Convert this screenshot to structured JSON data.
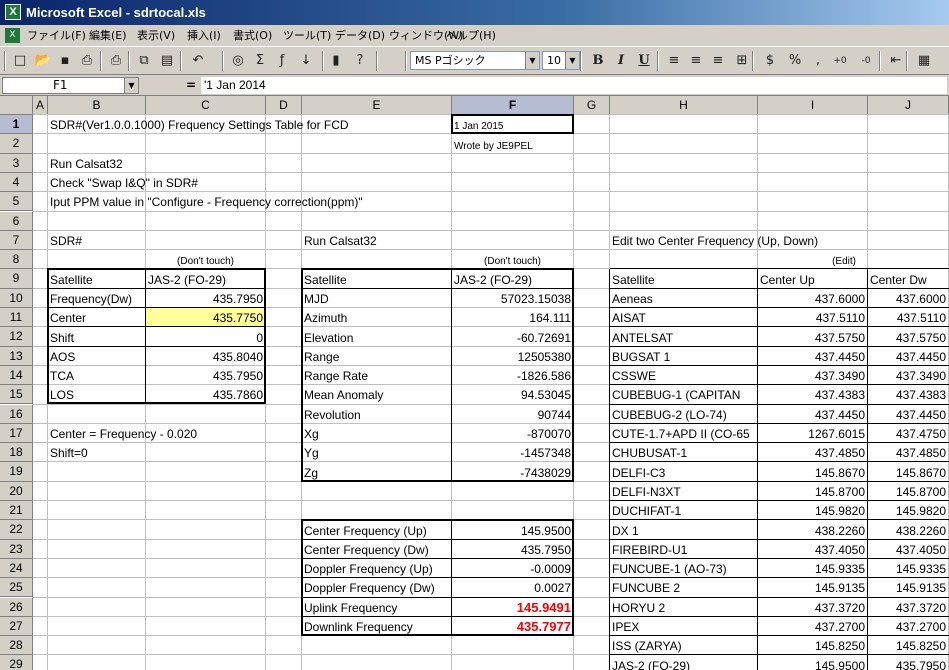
{
  "window": {
    "title": "Microsoft Excel - sdrtocal.xls"
  },
  "menu": [
    "ファイル(F)",
    "編集(E)",
    "表示(V)",
    "挿入(I)",
    "書式(O)",
    "ツール(T)",
    "データ(D)",
    "ウィンドウ(W)",
    "ヘルプ(H)"
  ],
  "toolbar": {
    "font_name": "MS Pゴシック",
    "font_size": "10"
  },
  "formula_bar": {
    "cell_ref": "F1",
    "equals": "=",
    "content": "'1  Jan 2014"
  },
  "columns": [
    "A",
    "B",
    "C",
    "D",
    "E",
    "F",
    "G",
    "H",
    "I",
    "J"
  ],
  "rows": [
    "1",
    "2",
    "3",
    "4",
    "5",
    "6",
    "7",
    "8",
    "9",
    "10",
    "11",
    "12",
    "13",
    "14",
    "15",
    "16",
    "17",
    "18",
    "19",
    "20",
    "21",
    "22",
    "23",
    "24",
    "25",
    "26",
    "27",
    "28",
    "29"
  ],
  "sheet": {
    "b1": "SDR#(Ver1.0.0.1000) Frequency Settings Table for FCD",
    "f1": "1  Jan 2015",
    "f2": "Wrote by JE9PEL",
    "b3": "Run Calsat32",
    "b4": "Check \"Swap I&Q\" in SDR#",
    "b5": "Iput PPM value in \"Configure - Frequency correction(ppm)\"",
    "b7": "SDR#",
    "e7": "Run Calsat32",
    "h7": "Edit two Center Frequency (Up, Down)",
    "c8": "(Don't touch)",
    "f8": "(Don't touch)",
    "i8": "(Edit)",
    "sdr_table": [
      {
        "label": "Satellite",
        "value": "JAS-2 (FO-29)"
      },
      {
        "label": "Frequency(Dw)",
        "value": "435.7950"
      },
      {
        "label": "Center",
        "value": "435.7750"
      },
      {
        "label": "Shift",
        "value": "0"
      },
      {
        "label": "AOS",
        "value": "435.8040"
      },
      {
        "label": "TCA",
        "value": "435.7950"
      },
      {
        "label": "LOS",
        "value": "435.7860"
      }
    ],
    "b17": "Center = Frequency - 0.020",
    "b18": "Shift=0",
    "calsat_table": [
      {
        "label": "Satellite",
        "value": "JAS-2 (FO-29)"
      },
      {
        "label": "MJD",
        "value": "57023.15038"
      },
      {
        "label": "Azimuth",
        "value": "164.111"
      },
      {
        "label": "Elevation",
        "value": "-60.72691"
      },
      {
        "label": "Range",
        "value": "12505380"
      },
      {
        "label": "Range Rate",
        "value": "-1826.586"
      },
      {
        "label": "Mean Anomaly",
        "value": "94.53045"
      },
      {
        "label": "Revolution",
        "value": "90744"
      },
      {
        "label": "Xg",
        "value": "-870070"
      },
      {
        "label": "Yg",
        "value": "-1457348"
      },
      {
        "label": "Zg",
        "value": "-7438029"
      }
    ],
    "freq_table": [
      {
        "label": "Center Frequency (Up)",
        "value": "145.9500"
      },
      {
        "label": "Center Frequency (Dw)",
        "value": "435.7950"
      },
      {
        "label": "Doppler Frequency (Up)",
        "value": "-0.0009"
      },
      {
        "label": "Doppler Frequency (Dw)",
        "value": "0.0027"
      },
      {
        "label": "Uplink Frequency",
        "value": "145.9491"
      },
      {
        "label": "Downlink Frequency",
        "value": "435.7977"
      }
    ],
    "sat_header": {
      "h": "Satellite",
      "i": "Center Up",
      "j": "Center Dw"
    },
    "satellites": [
      {
        "name": "Aeneas",
        "up": "437.6000",
        "dw": "437.6000"
      },
      {
        "name": "AISAT",
        "up": "437.5110",
        "dw": "437.5110"
      },
      {
        "name": "ANTELSAT",
        "up": "437.5750",
        "dw": "437.5750"
      },
      {
        "name": "BUGSAT 1",
        "up": "437.4450",
        "dw": "437.4450"
      },
      {
        "name": "CSSWE",
        "up": "437.3490",
        "dw": "437.3490"
      },
      {
        "name": "CUBEBUG-1 (CAPITAN",
        "up": "437.4383",
        "dw": "437.4383"
      },
      {
        "name": "CUBEBUG-2 (LO-74)",
        "up": "437.4450",
        "dw": "437.4450"
      },
      {
        "name": "CUTE-1.7+APD II (CO-65",
        "up": "1267.6015",
        "dw": "437.4750"
      },
      {
        "name": "CHUBUSAT-1",
        "up": "437.4850",
        "dw": "437.4850"
      },
      {
        "name": "DELFI-C3",
        "up": "145.8670",
        "dw": "145.8670"
      },
      {
        "name": "DELFI-N3XT",
        "up": "145.8700",
        "dw": "145.8700"
      },
      {
        "name": "DUCHIFAT-1",
        "up": "145.9820",
        "dw": "145.9820"
      },
      {
        "name": "DX 1",
        "up": "438.2260",
        "dw": "438.2260"
      },
      {
        "name": "FIREBIRD-U1",
        "up": "437.4050",
        "dw": "437.4050"
      },
      {
        "name": "FUNCUBE-1 (AO-73)",
        "up": "145.9335",
        "dw": "145.9335"
      },
      {
        "name": "FUNCUBE 2",
        "up": "145.9135",
        "dw": "145.9135"
      },
      {
        "name": "HORYU 2",
        "up": "437.3720",
        "dw": "437.3720"
      },
      {
        "name": "IPEX",
        "up": "437.2700",
        "dw": "437.2700"
      },
      {
        "name": "ISS (ZARYA)",
        "up": "145.8250",
        "dw": "145.8250"
      },
      {
        "name": "JAS-2 (FO-29)",
        "up": "145.9500",
        "dw": "435.7950"
      }
    ]
  },
  "colors": {
    "highlight_yellow": "#ffff99",
    "result_red": "#ff0000",
    "title_blue": "#0a246a"
  }
}
